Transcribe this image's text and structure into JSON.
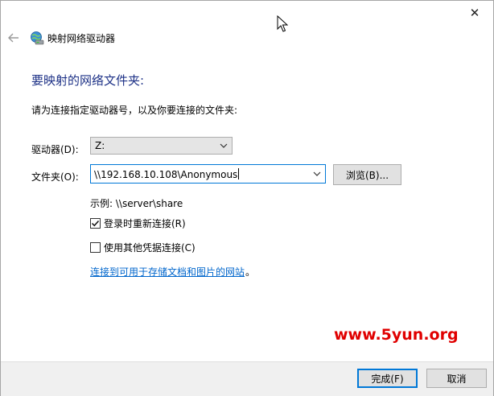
{
  "title_bar": {
    "close_glyph": "✕"
  },
  "wizard": {
    "title": "映射网络驱动器",
    "heading": "要映射的网络文件夹:",
    "instruction": "请为连接指定驱动器号，以及你要连接的文件夹:"
  },
  "form": {
    "drive_label": "驱动器(D):",
    "drive_value": "Z:",
    "folder_label": "文件夹(O):",
    "folder_value": "\\\\192.168.10.108\\Anonymous",
    "browse_label": "浏览(B)...",
    "example_text": "示例: \\\\server\\share"
  },
  "options": [
    {
      "label": "登录时重新连接(R)",
      "checked": true
    },
    {
      "label": "使用其他凭据连接(C)",
      "checked": false
    }
  ],
  "link": {
    "text": "连接到可用于存储文档和图片的网站",
    "suffix": "。"
  },
  "watermark": "www.5yun.org",
  "footer": {
    "finish_label": "完成(F)",
    "cancel_label": "取消"
  },
  "colors": {
    "accent": "#0078d7",
    "heading": "#1e3287",
    "link": "#0066cc",
    "watermark": "#e00000"
  }
}
